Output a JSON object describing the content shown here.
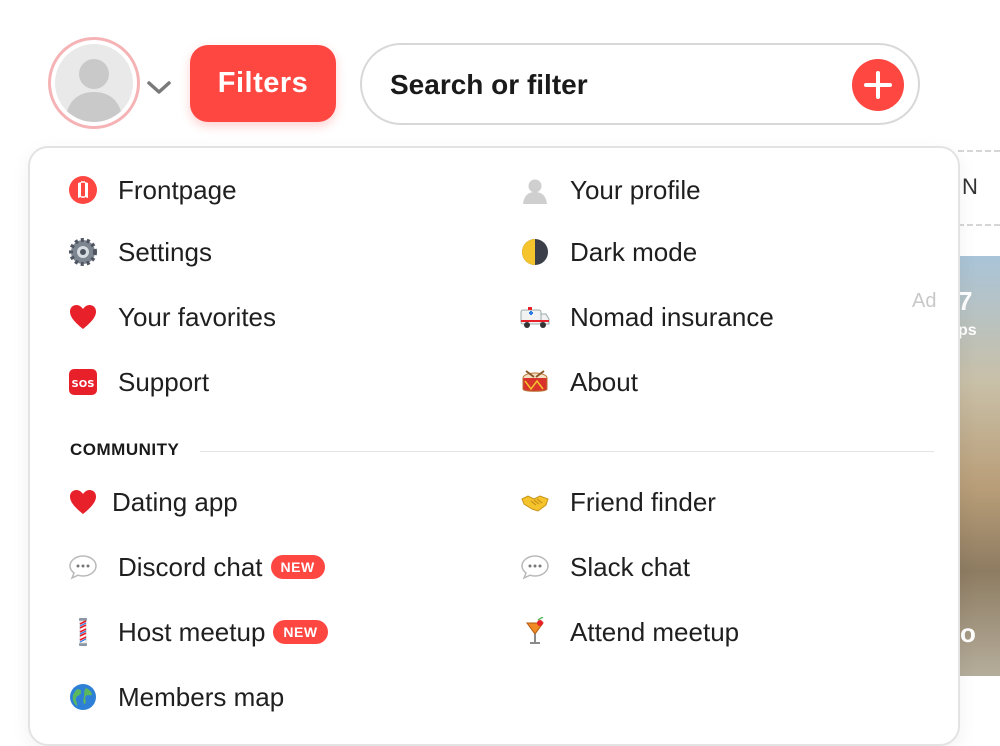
{
  "header": {
    "filters_label": "Filters",
    "search_label": "Search or filter"
  },
  "menu": {
    "ad_label": "Ad",
    "main_items": [
      {
        "label": "Frontpage",
        "icon": "nomad-logo-icon"
      },
      {
        "label": "Settings",
        "icon": "gear-icon"
      },
      {
        "label": "Your favorites",
        "icon": "heart-icon"
      },
      {
        "label": "Support",
        "icon": "sos-icon"
      },
      {
        "label": "Your profile",
        "icon": "person-silhouette-icon"
      },
      {
        "label": "Dark mode",
        "icon": "half-moon-icon"
      },
      {
        "label": "Nomad insurance",
        "icon": "ambulance-icon"
      },
      {
        "label": "About",
        "icon": "drum-icon"
      }
    ],
    "community_heading": "COMMUNITY",
    "community_items": [
      {
        "label": "Dating app",
        "icon": "heart-icon"
      },
      {
        "label": "Discord chat",
        "icon": "speech-bubble-icon",
        "badge": "NEW"
      },
      {
        "label": "Host meetup",
        "icon": "barber-pole-icon",
        "badge": "NEW"
      },
      {
        "label": "Members map",
        "icon": "globe-icon"
      },
      {
        "label": "Friend finder",
        "icon": "handshake-icon"
      },
      {
        "label": "Slack chat",
        "icon": "speech-bubble-icon"
      },
      {
        "label": "Attend meetup",
        "icon": "cocktail-icon"
      }
    ]
  },
  "background": {
    "peek_text": "N",
    "ad_text_1": "7",
    "ad_text_2": "ps",
    "ad_text_3": "o"
  },
  "colors": {
    "accent": "#ff4742",
    "avatar_ring": "#f5b3b5"
  }
}
